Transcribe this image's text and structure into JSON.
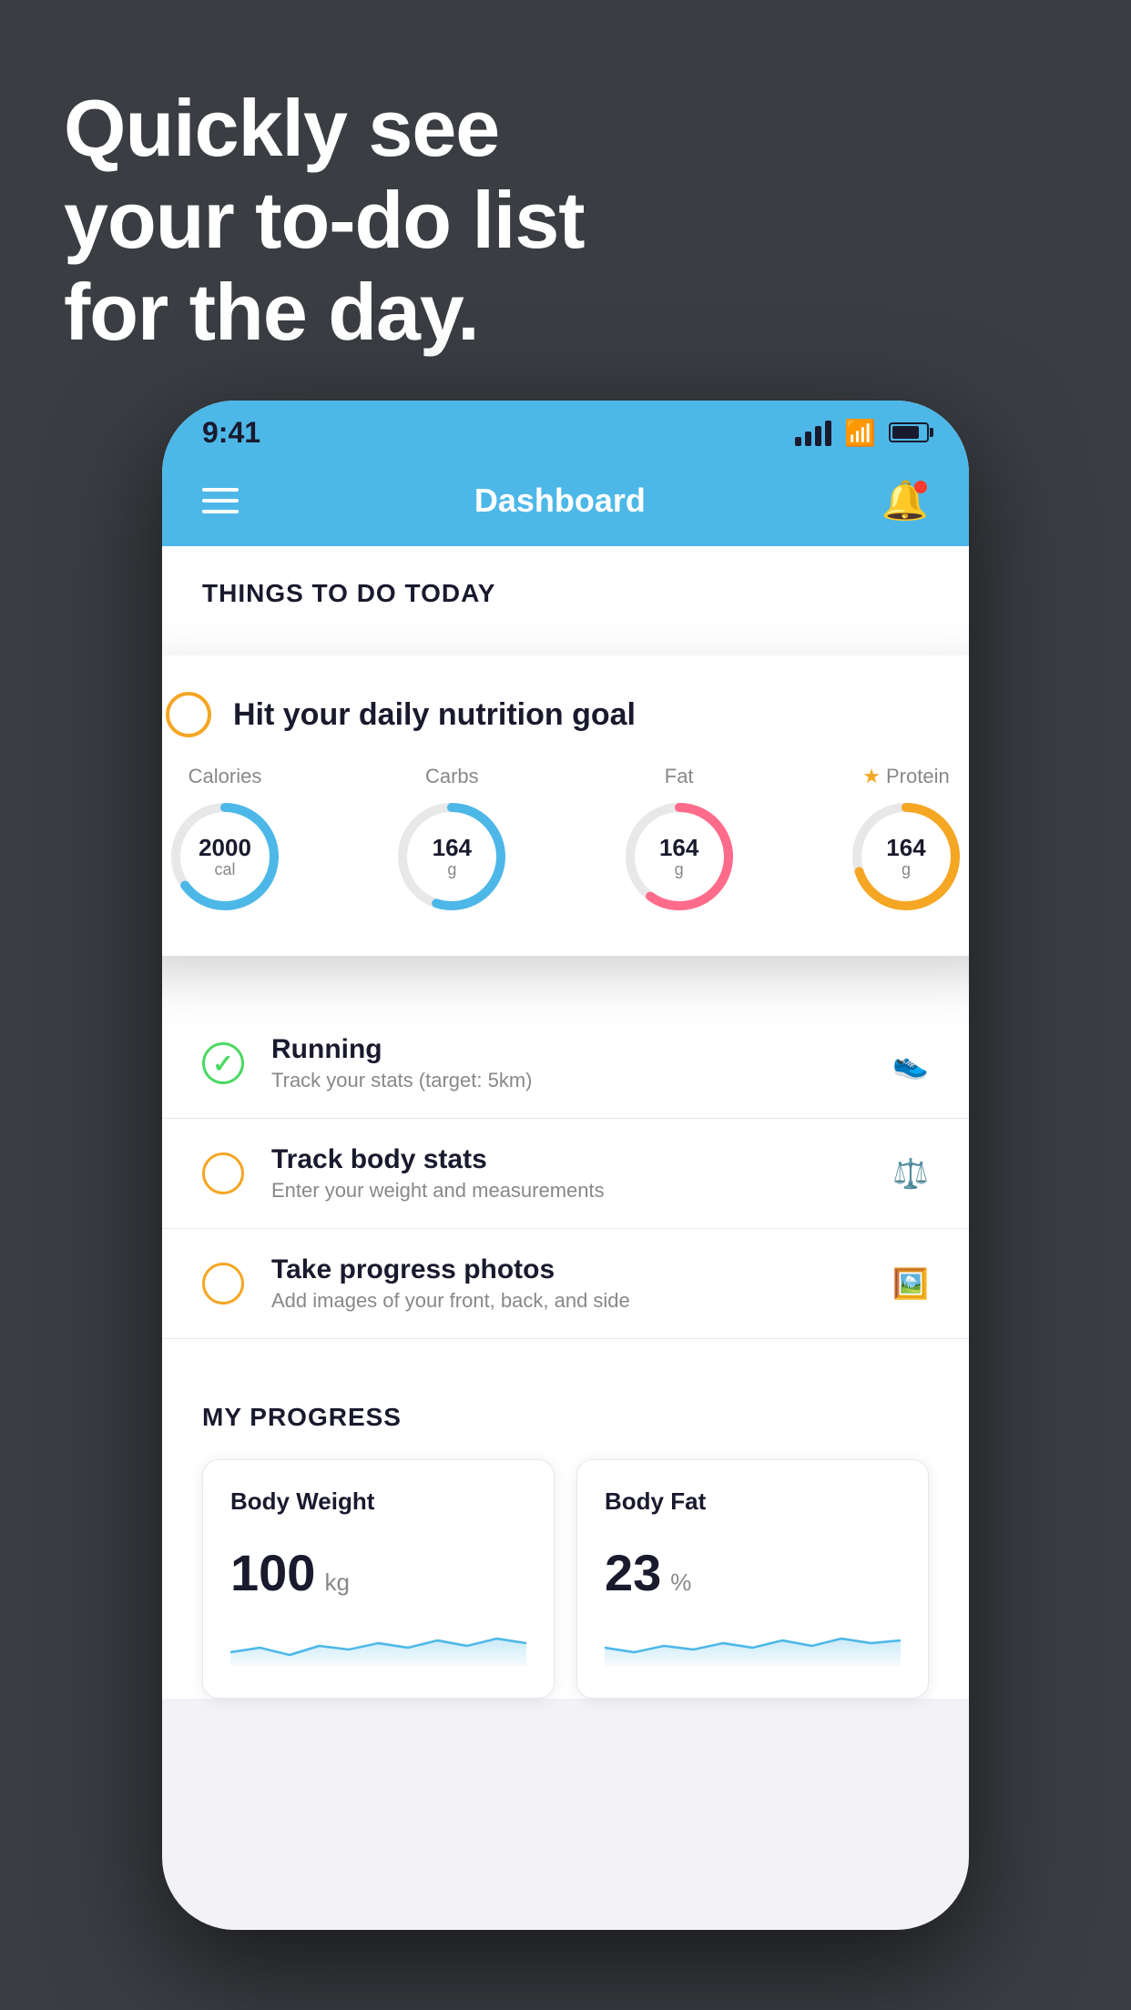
{
  "headline": {
    "line1": "Quickly see",
    "line2": "your to-do list",
    "line3": "for the day."
  },
  "status_bar": {
    "time": "9:41"
  },
  "nav": {
    "title": "Dashboard"
  },
  "things_section": {
    "label": "THINGS TO DO TODAY"
  },
  "floating_card": {
    "title": "Hit your daily nutrition goal",
    "nutrition": [
      {
        "label": "Calories",
        "value": "2000",
        "unit": "cal",
        "color": "#4db8e8",
        "pct": 65,
        "starred": false
      },
      {
        "label": "Carbs",
        "value": "164",
        "unit": "g",
        "color": "#4db8e8",
        "pct": 55,
        "starred": false
      },
      {
        "label": "Fat",
        "value": "164",
        "unit": "g",
        "color": "#ff6b8a",
        "pct": 60,
        "starred": false
      },
      {
        "label": "Protein",
        "value": "164",
        "unit": "g",
        "color": "#f5a623",
        "pct": 70,
        "starred": true
      }
    ]
  },
  "todo_items": [
    {
      "main": "Running",
      "sub": "Track your stats (target: 5km)",
      "circle_color": "green",
      "completed": true
    },
    {
      "main": "Track body stats",
      "sub": "Enter your weight and measurements",
      "circle_color": "yellow",
      "completed": false
    },
    {
      "main": "Take progress photos",
      "sub": "Add images of your front, back, and side",
      "circle_color": "yellow",
      "completed": false
    }
  ],
  "progress_section": {
    "title": "MY PROGRESS",
    "cards": [
      {
        "title": "Body Weight",
        "value": "100",
        "unit": "kg"
      },
      {
        "title": "Body Fat",
        "value": "23",
        "unit": "%"
      }
    ]
  }
}
